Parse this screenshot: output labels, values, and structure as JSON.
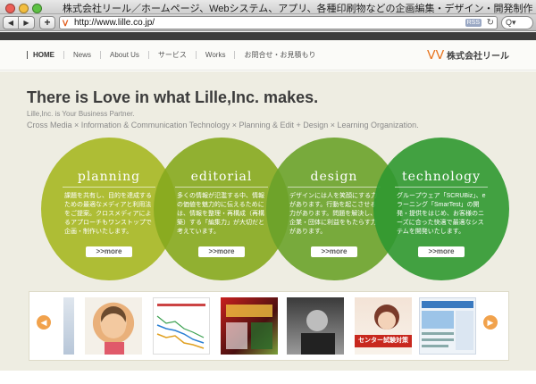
{
  "window": {
    "title": "株式会社リール／ホームページ、Webシステム、アプリ、各種印刷物などの企画編集・デザイン・開発制作",
    "url": "http://www.lille.co.jp/",
    "rss_label": "RSS",
    "search_glyph": "Q▾"
  },
  "nav": {
    "items": [
      "HOME",
      "News",
      "About Us",
      "サービス",
      "Works",
      "お問合せ・お見積もり"
    ]
  },
  "logo": {
    "text": "株式会社リール"
  },
  "hero": {
    "headline": "There is Love in what Lille,Inc. makes.",
    "sub1": "Lille,Inc. is Your Business Partner.",
    "sub2": "Cross Media × Information & Communication Technology × Planning & Edit + Design × Learning Organization."
  },
  "circles": [
    {
      "title": "planning",
      "body": "課題を共有し、目的を達成するための最適なメディアと利用法をご提案。クロスメディアによるアプローチもワンストップで企画・制作いたします。",
      "more": ">>more",
      "color": "#a8b826"
    },
    {
      "title": "editorial",
      "body": "多くの情報が氾濫する中、情報の価値を魅力的に伝えるためには、情報を整理・再構成（再構築）する「編集力」が大切だと考えています。",
      "more": ">>more",
      "color": "#86a81e"
    },
    {
      "title": "design",
      "body": "デザインには人を笑顔にする力があります。行動を起こさせる力があります。問題を解決し、企業・団体に利益をもたらす力があります。",
      "more": ">>more",
      "color": "#6aa22a"
    },
    {
      "title": "technology",
      "body": "グループウェア「SCRUBiz」、eラーニング「SmarTest」の開発・提供をはじめ、お客様のニーズに合った快適で最適なシステムを開発いたします。",
      "more": ">>more",
      "color": "#2f9830"
    }
  ],
  "carousel": {
    "prev_glyph": "◀",
    "next_glyph": "▶",
    "thumbs": [
      "site-preview",
      "child-photo",
      "line-chart",
      "brochure",
      "portrait-photo",
      "exam-poster",
      "web-page"
    ],
    "poster_text": "センター試験対策"
  }
}
